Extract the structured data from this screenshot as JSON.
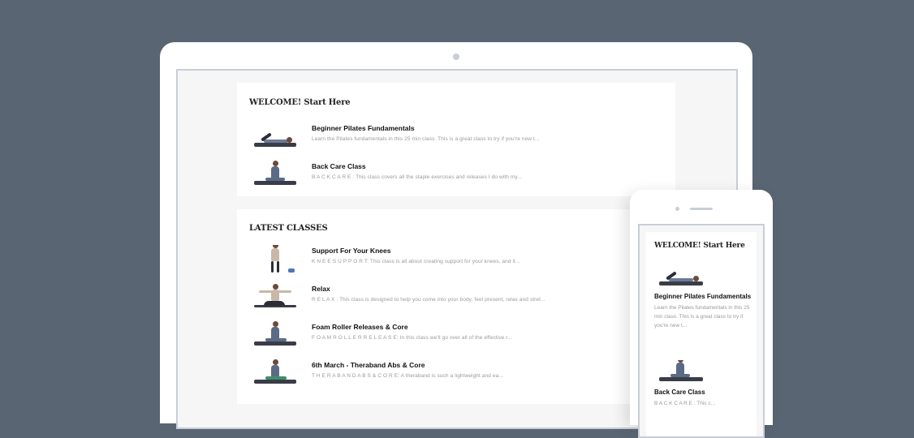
{
  "welcome": {
    "title": "WELCOME! Start Here",
    "items": [
      {
        "title": "Beginner Pilates Fundamentals",
        "desc": "Learn the Pilates fundamentals in this 25 min class. This is a great class to try if you're new t..."
      },
      {
        "title": "Back Care Class",
        "desc": "B A C K  C A R E : This class covers all the staple exercises and releases I do with my..."
      }
    ]
  },
  "latest": {
    "title": "LATEST CLASSES",
    "items": [
      {
        "title": "Support For Your Knees",
        "desc": "K N E E  S U P P O R T: This class is all about creating support for your knees, and it..."
      },
      {
        "title": "Relax",
        "desc": "R E L A X : This class is designed to help you come into your body, feel present, relax and stret..."
      },
      {
        "title": "Foam Roller Releases & Core",
        "desc": "F O A M  R O L L E R  R E L E A S E: In this class we'll go over all of the effective r..."
      },
      {
        "title": "6th March - Theraband Abs & Core",
        "desc": "T H E R A B A N D  A B S  &  C O R E: A theraband is such a lightweight and ea..."
      }
    ]
  },
  "phone": {
    "title": "WELCOME! Start Here",
    "item1_title": "Beginner Pilates Fundamentals",
    "item1_desc": "Learn the Pilates fundamentals in this 25 min class. This is a great class to try if you're new t...",
    "item2_title": "Back Care Class",
    "item2_desc": "B A C K  C A R E : This c..."
  },
  "colors": {
    "background": "#5a6573",
    "device": "#ffffff",
    "screen": "#f6f6f6"
  }
}
